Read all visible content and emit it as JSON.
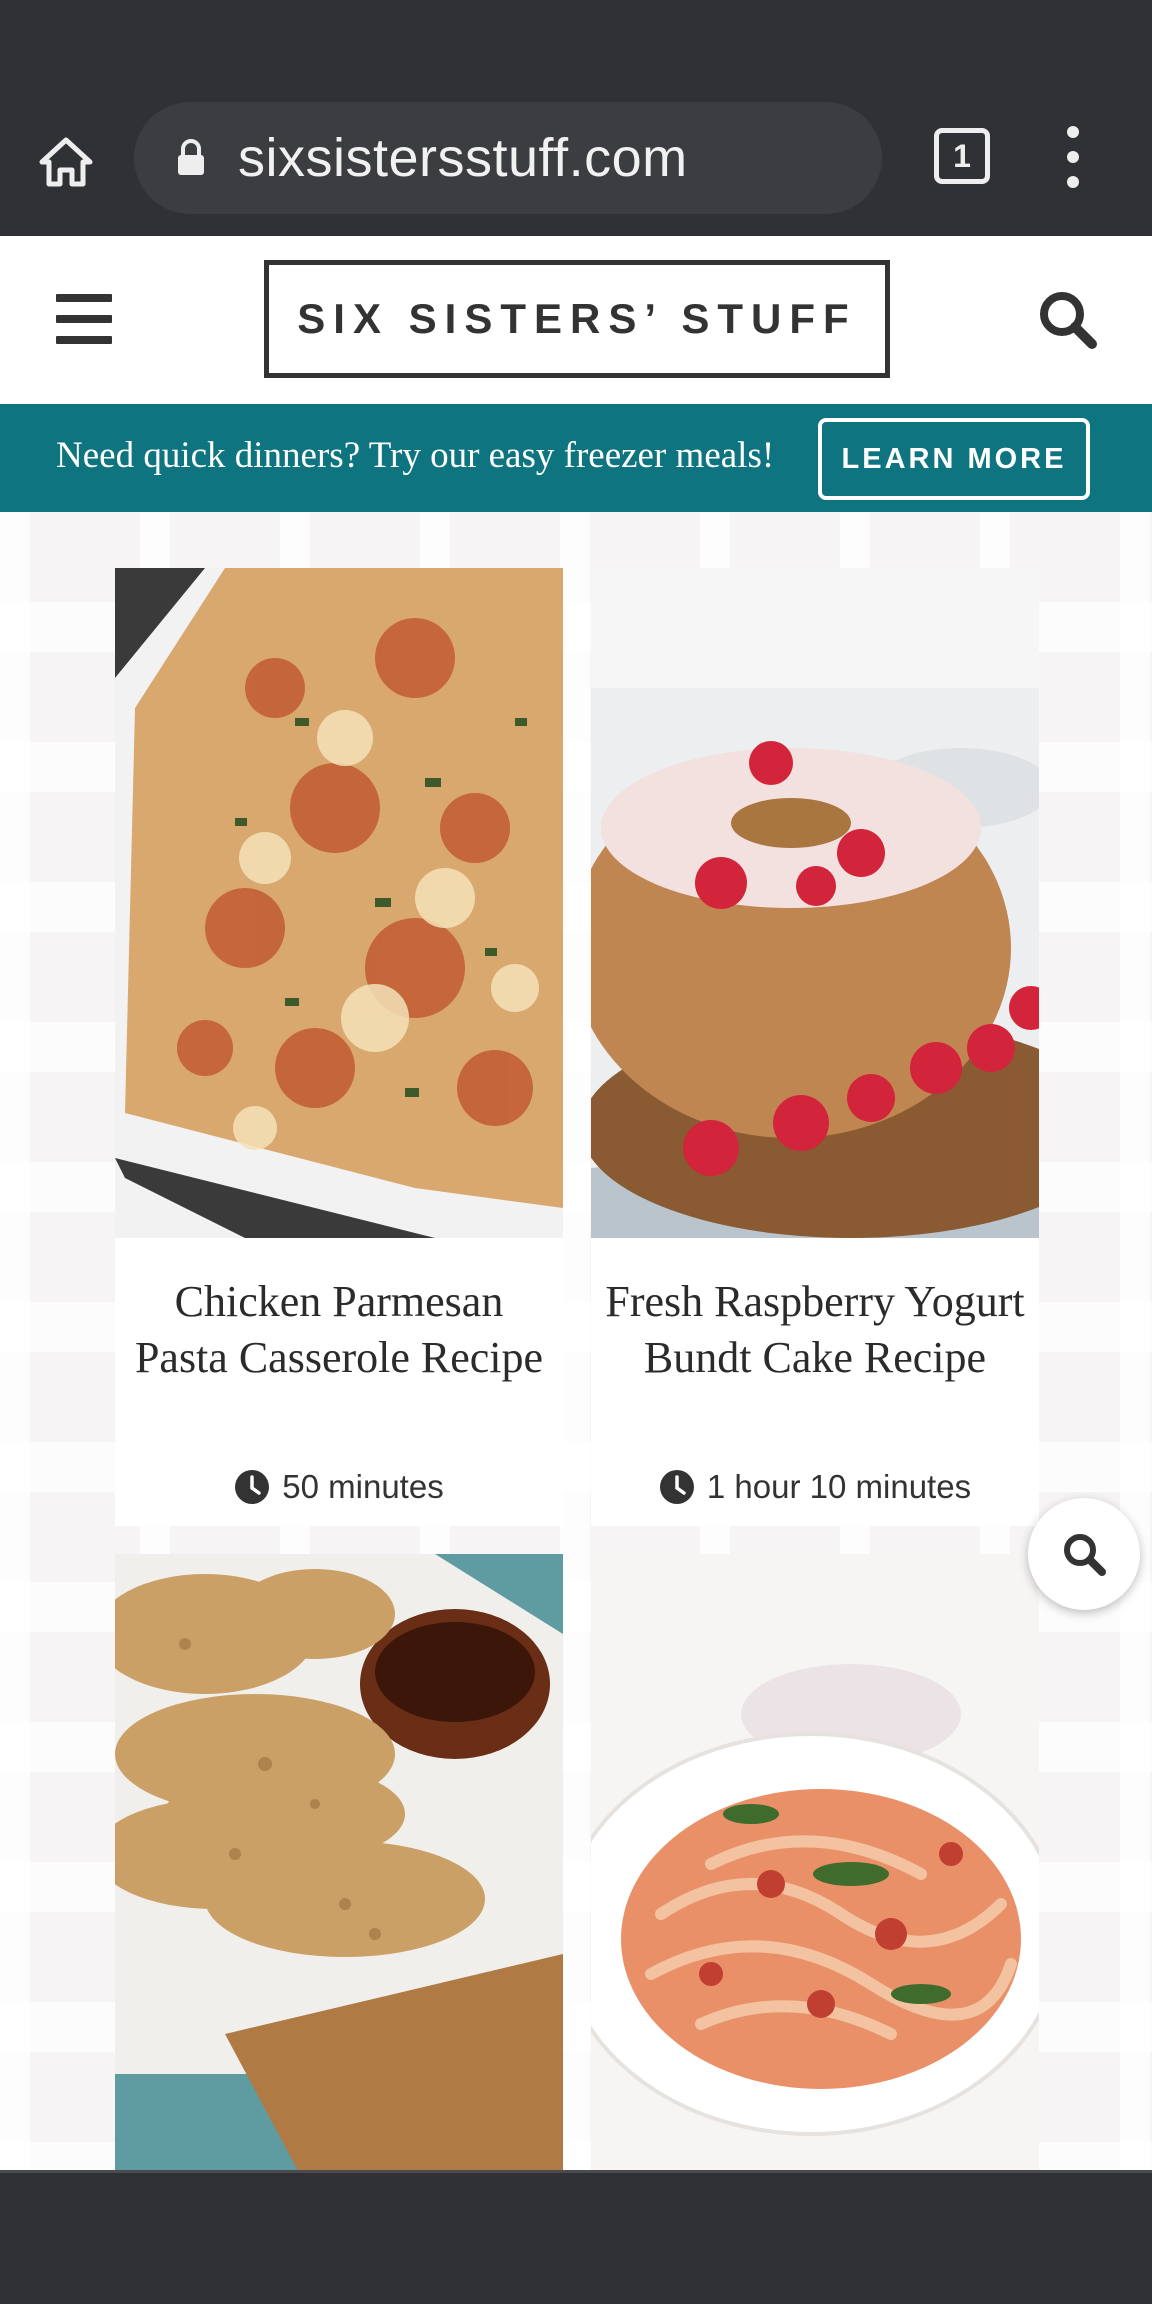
{
  "browser": {
    "url": "sixsistersstuff.com",
    "tab_count": "1",
    "icons": [
      "home-icon",
      "lock-icon",
      "tabs-icon",
      "more-vert-icon"
    ]
  },
  "header": {
    "logo": "SIX SISTERS’ STUFF",
    "icons": [
      "hamburger-icon",
      "search-icon"
    ]
  },
  "promo": {
    "text": "Need quick dinners? Try our easy freezer meals!",
    "button": "LEARN MORE",
    "color": "#0e7480"
  },
  "recipes": [
    {
      "title": "Chicken Parmesan Pasta Casserole Recipe",
      "time": "50 minutes",
      "image": "pasta-casserole"
    },
    {
      "title": "Fresh Raspberry Yogurt Bundt Cake Recipe",
      "time": "1 hour 10 minutes",
      "image": "raspberry-bundt-cake"
    },
    {
      "title": "",
      "time": "",
      "image": "breaded-chicken-tenders"
    },
    {
      "title": "",
      "time": "",
      "image": "pasta-bowl"
    }
  ],
  "colors": {
    "chrome": "#303134",
    "teal": "#0e7480",
    "text_dark": "#333333"
  }
}
